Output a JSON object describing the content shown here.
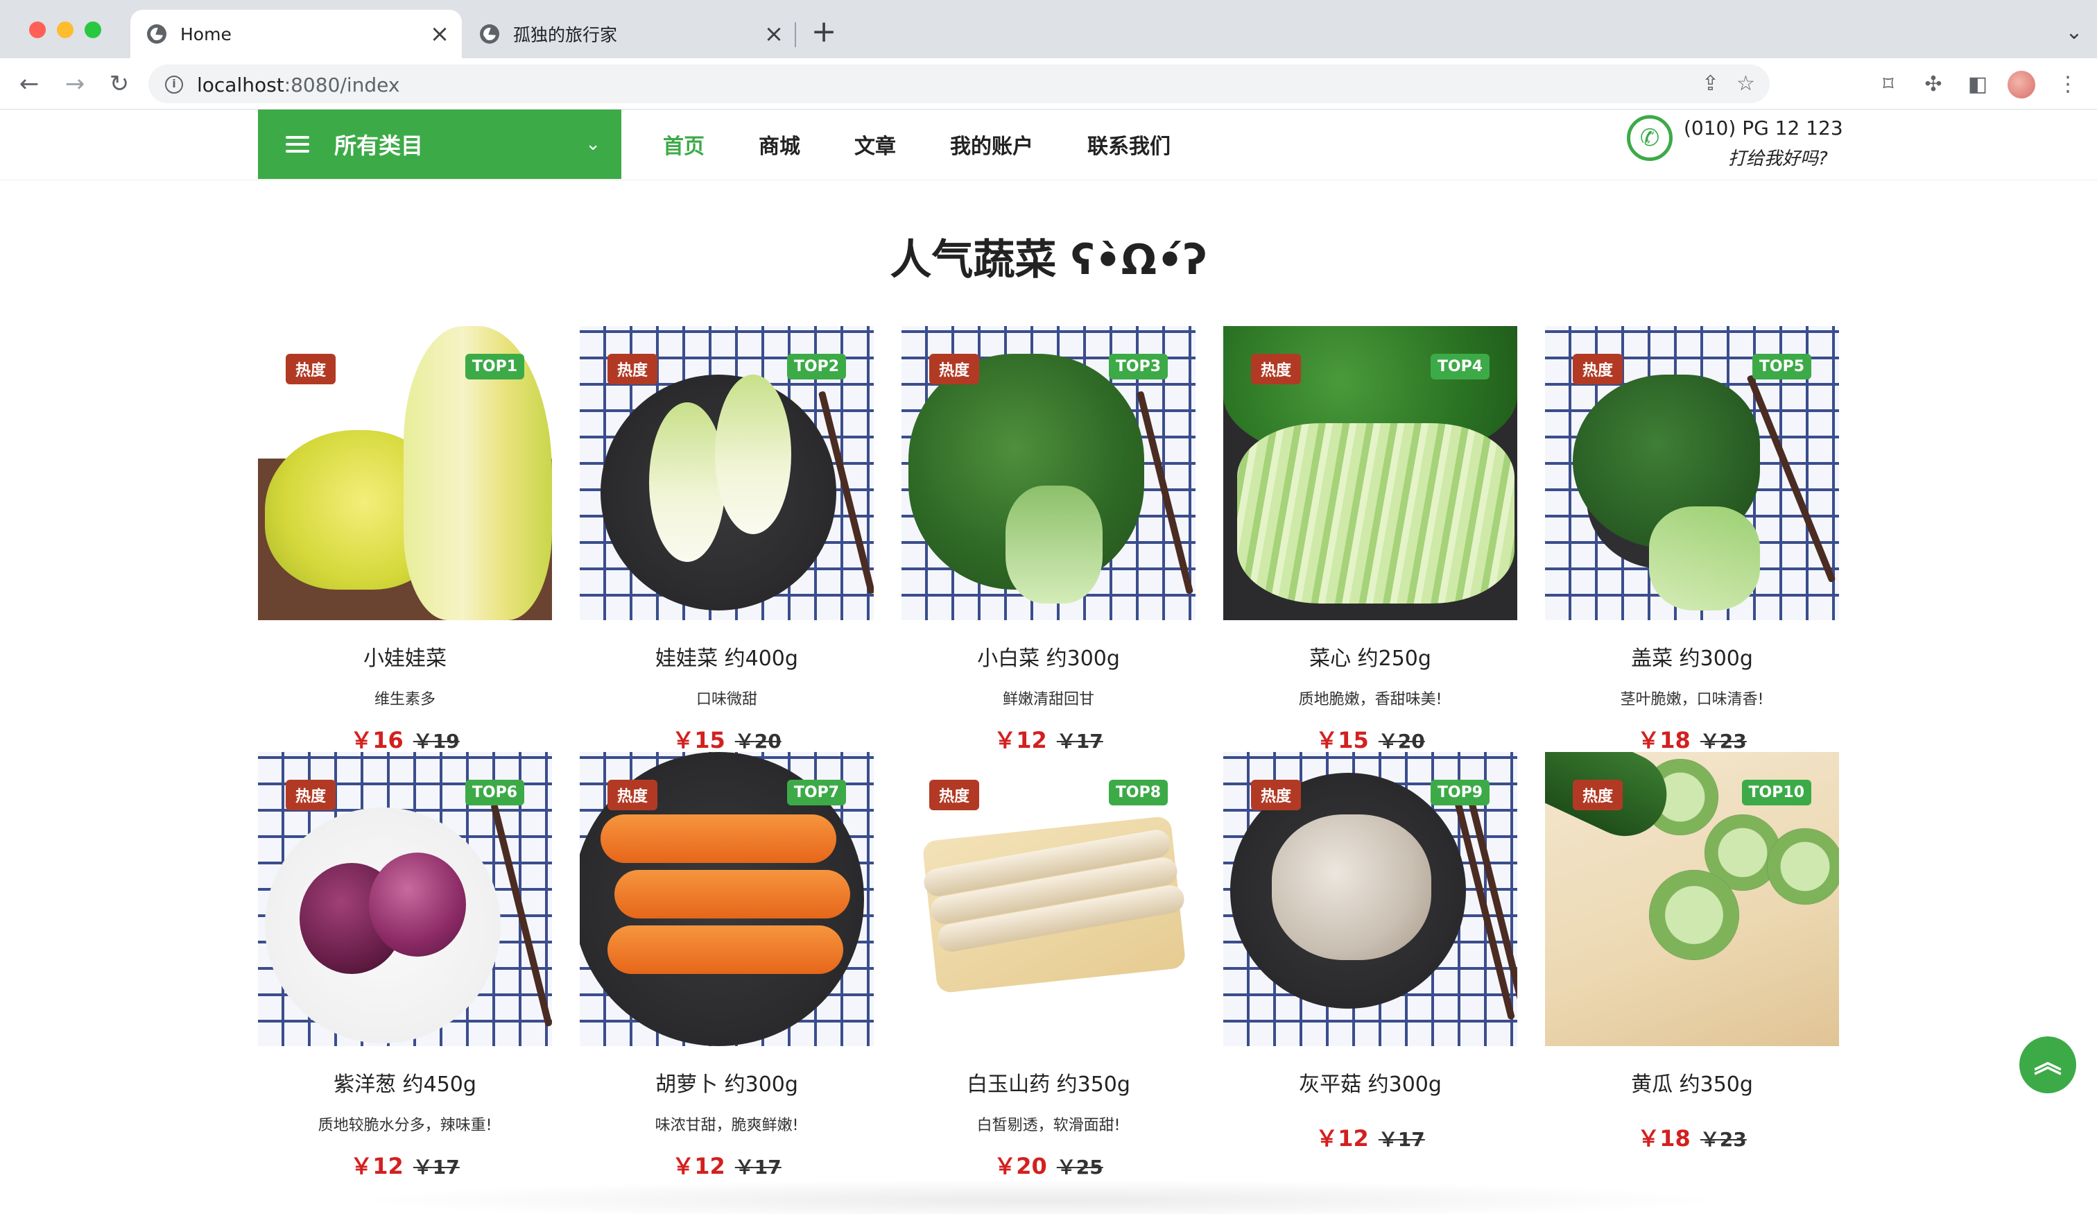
{
  "browser": {
    "tabs": [
      {
        "title": "Home",
        "active": true
      },
      {
        "title": "孤独的旅行家",
        "active": false
      }
    ],
    "url_host": "localhost",
    "url_path": ":8080/index"
  },
  "header": {
    "category_label": "所有类目",
    "nav": [
      "首页",
      "商城",
      "文章",
      "我的账户",
      "联系我们"
    ],
    "phone": "(010) PG 12 123",
    "phone_sub": "打给我好吗?"
  },
  "section_title": "人气蔬菜 ʕ•̀Ω•́ʔ",
  "hot_label": "热度",
  "currency": "￥",
  "products": [
    {
      "rank": "TOP1",
      "name": "小娃娃菜",
      "desc": "维生素多",
      "price": "16",
      "old_price": "19"
    },
    {
      "rank": "TOP2",
      "name": "娃娃菜 约400g",
      "desc": "口味微甜",
      "price": "15",
      "old_price": "20"
    },
    {
      "rank": "TOP3",
      "name": "小白菜 约300g",
      "desc": "鲜嫩清甜回甘",
      "price": "12",
      "old_price": "17"
    },
    {
      "rank": "TOP4",
      "name": "菜心 约250g",
      "desc": "质地脆嫩，香甜味美!",
      "price": "15",
      "old_price": "20"
    },
    {
      "rank": "TOP5",
      "name": "盖菜 约300g",
      "desc": "茎叶脆嫩，口味清香!",
      "price": "18",
      "old_price": "23"
    },
    {
      "rank": "TOP6",
      "name": "紫洋葱 约450g",
      "desc": "质地较脆水分多，辣味重!",
      "price": "12",
      "old_price": "17"
    },
    {
      "rank": "TOP7",
      "name": "胡萝卜 约300g",
      "desc": "味浓甘甜，脆爽鲜嫩!",
      "price": "12",
      "old_price": "17"
    },
    {
      "rank": "TOP8",
      "name": "白玉山药 约350g",
      "desc": "白皙剔透，软滑面甜!",
      "price": "20",
      "old_price": "25"
    },
    {
      "rank": "TOP9",
      "name": "灰平菇 约300g",
      "desc": "",
      "price": "12",
      "old_price": "17"
    },
    {
      "rank": "TOP10",
      "name": "黄瓜 约350g",
      "desc": "",
      "price": "18",
      "old_price": "23"
    }
  ],
  "colors": {
    "brand": "#3daa48",
    "hot_badge": "#b23a24",
    "price": "#d3201f"
  }
}
